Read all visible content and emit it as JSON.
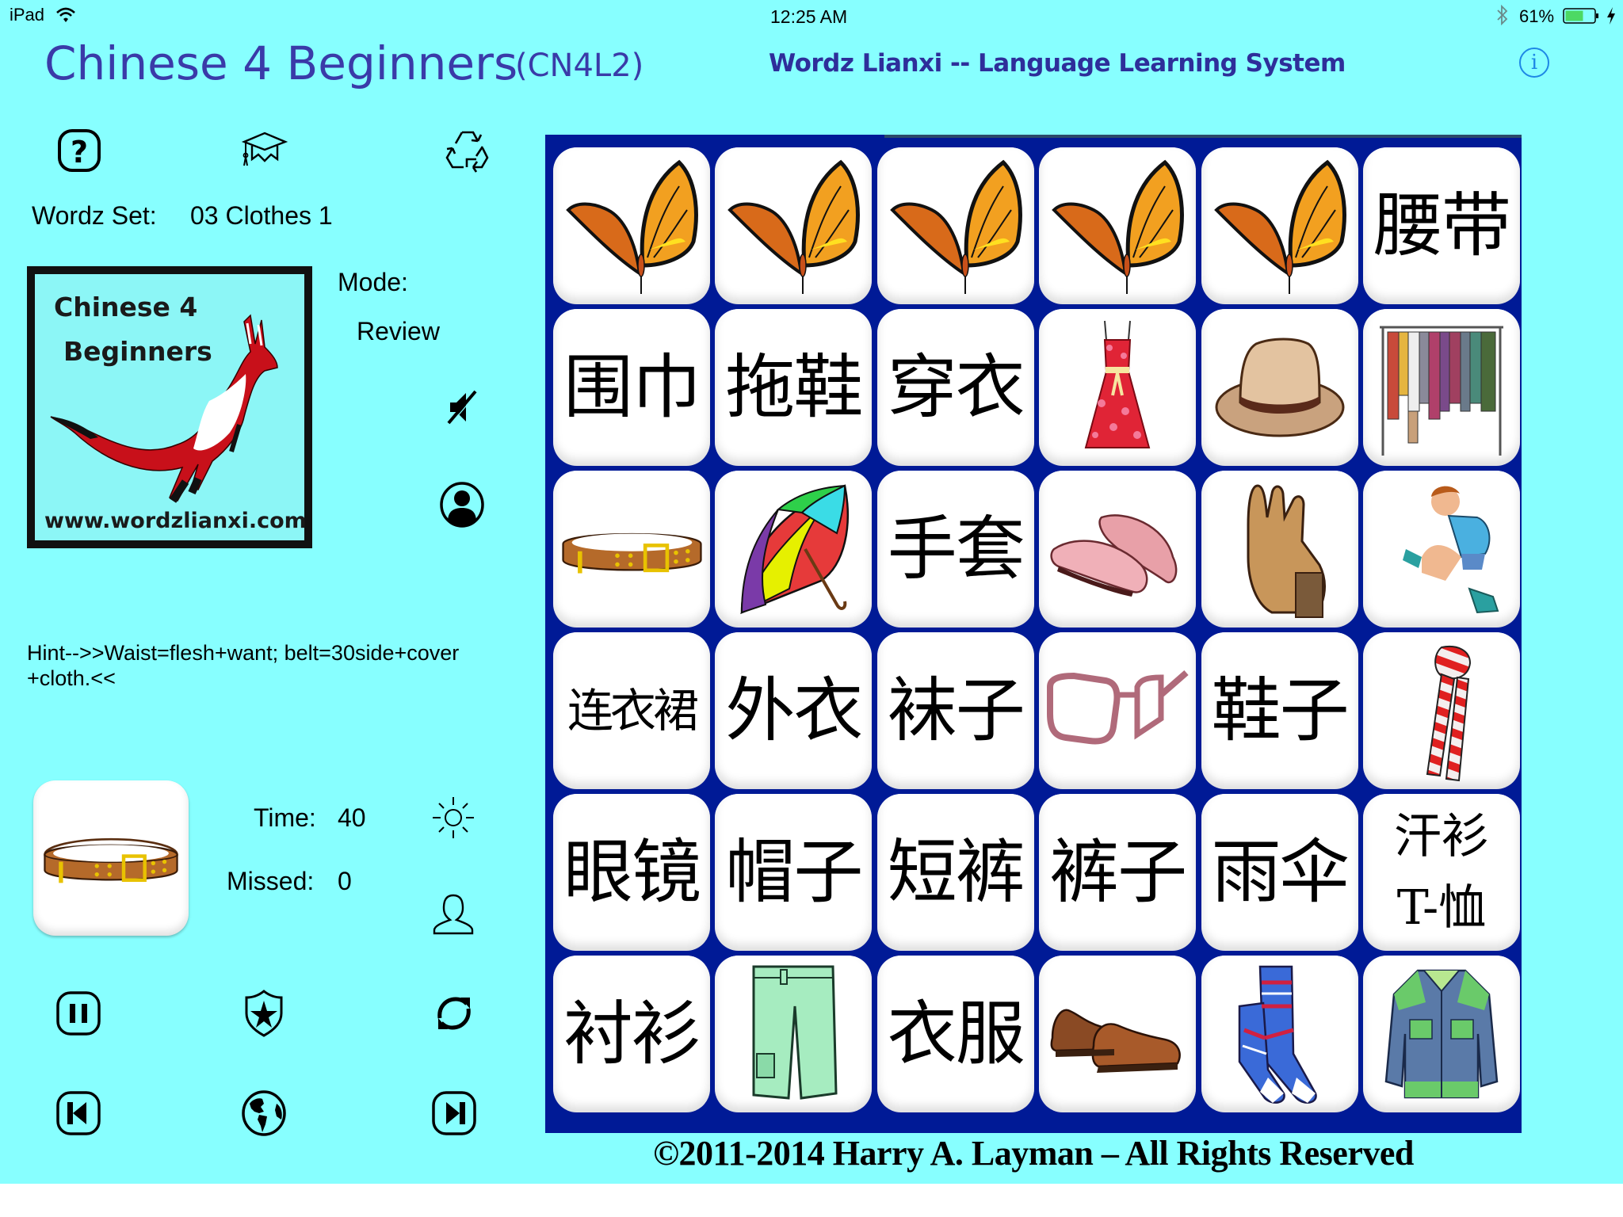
{
  "status_bar": {
    "device": "iPad",
    "time": "12:25 AM",
    "battery_percent": "61%",
    "battery_level": 0.61,
    "icons": [
      "wifi-icon",
      "bluetooth-icon",
      "battery-icon",
      "charging-icon"
    ]
  },
  "header": {
    "app_title": "Chinese 4 Beginners",
    "app_code": "(CN4L2)",
    "system_title": "Wordz Lianxi -- Language Learning System",
    "info_icon": "i"
  },
  "sidebar": {
    "top_icons": [
      "help-icon",
      "graduation-cap-icon",
      "recycle-icon"
    ],
    "wordz_set_label": "Wordz Set:",
    "wordz_set_value": "03 Clothes 1",
    "logo": {
      "line1": "Chinese 4",
      "line2": "Beginners",
      "url": "www.wordzlianxi.com"
    },
    "mode_label": "Mode:",
    "mode_value": "Review",
    "hint": "Hint-->>Waist=flesh+want; belt=30side+cover +cloth.<<",
    "current_card": "belt",
    "time_label": "Time:",
    "time_value": "40",
    "missed_label": "Missed:",
    "missed_value": "0",
    "bottom_icons": [
      "pause-icon",
      "shield-star-icon",
      "refresh-icon",
      "skip-back-icon",
      "globe-icon",
      "skip-forward-icon"
    ]
  },
  "board": {
    "rows": [
      [
        {
          "type": "image",
          "label": "butterfly"
        },
        {
          "type": "image",
          "label": "butterfly"
        },
        {
          "type": "image",
          "label": "butterfly"
        },
        {
          "type": "image",
          "label": "butterfly"
        },
        {
          "type": "image",
          "label": "butterfly"
        },
        {
          "type": "text",
          "label": "腰带"
        }
      ],
      [
        {
          "type": "text",
          "label": "围巾"
        },
        {
          "type": "text",
          "label": "拖鞋"
        },
        {
          "type": "text",
          "label": "穿衣"
        },
        {
          "type": "image",
          "label": "dress"
        },
        {
          "type": "image",
          "label": "hat"
        },
        {
          "type": "image",
          "label": "clothes-rack"
        }
      ],
      [
        {
          "type": "image",
          "label": "belt"
        },
        {
          "type": "image",
          "label": "umbrella"
        },
        {
          "type": "text",
          "label": "手套"
        },
        {
          "type": "image",
          "label": "slippers"
        },
        {
          "type": "image",
          "label": "gloves"
        },
        {
          "type": "image",
          "label": "boy-putting-on-socks"
        }
      ],
      [
        {
          "type": "text",
          "label": "连衣裙"
        },
        {
          "type": "text",
          "label": "外衣"
        },
        {
          "type": "text",
          "label": "袜子"
        },
        {
          "type": "image",
          "label": "glasses"
        },
        {
          "type": "text",
          "label": "鞋子"
        },
        {
          "type": "image",
          "label": "scarf"
        }
      ],
      [
        {
          "type": "text",
          "label": "眼镜"
        },
        {
          "type": "text",
          "label": "帽子"
        },
        {
          "type": "text",
          "label": "短裤"
        },
        {
          "type": "text",
          "label": "裤子"
        },
        {
          "type": "text",
          "label": "雨伞"
        },
        {
          "type": "text",
          "label": "汗衫",
          "label2": "T-恤"
        }
      ],
      [
        {
          "type": "text",
          "label": "衬衫"
        },
        {
          "type": "image",
          "label": "shorts"
        },
        {
          "type": "text",
          "label": "衣服"
        },
        {
          "type": "image",
          "label": "shoes"
        },
        {
          "type": "image",
          "label": "socks"
        },
        {
          "type": "image",
          "label": "jacket"
        }
      ]
    ]
  },
  "footer": {
    "copyright": "©2011-2014 Harry A. Layman – All Rights Reserved"
  },
  "colors": {
    "background": "#87FFFF",
    "board": "#001A96",
    "title": "#3A3AA8",
    "info": "#1E88E5",
    "battery": "#4CD964"
  }
}
